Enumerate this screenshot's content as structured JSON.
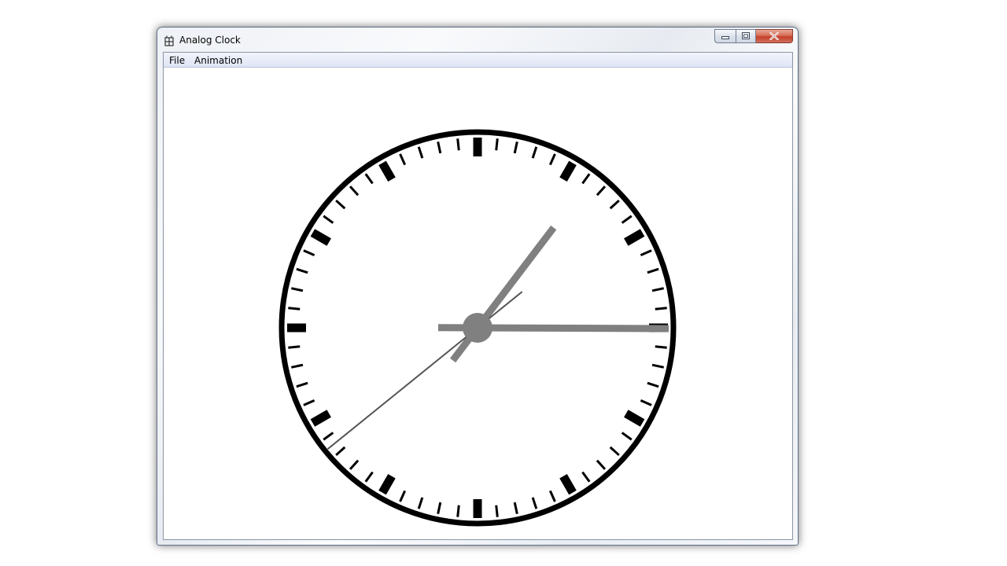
{
  "window": {
    "title": "Analog Clock",
    "icons": {
      "app": "app-icon",
      "minimize": "minimize-icon",
      "maximize": "maximize-icon",
      "close": "close-icon"
    }
  },
  "menubar": {
    "items": [
      {
        "label": "File"
      },
      {
        "label": "Animation"
      }
    ]
  },
  "clock": {
    "time": {
      "hour": 1,
      "minute": 14.4,
      "second": 38.5
    },
    "colors": {
      "face": "#ffffff",
      "rim": "#000000",
      "ticks": "#000000",
      "hands": "#808080",
      "second_hand": "#555555",
      "hub": "#808080"
    }
  }
}
